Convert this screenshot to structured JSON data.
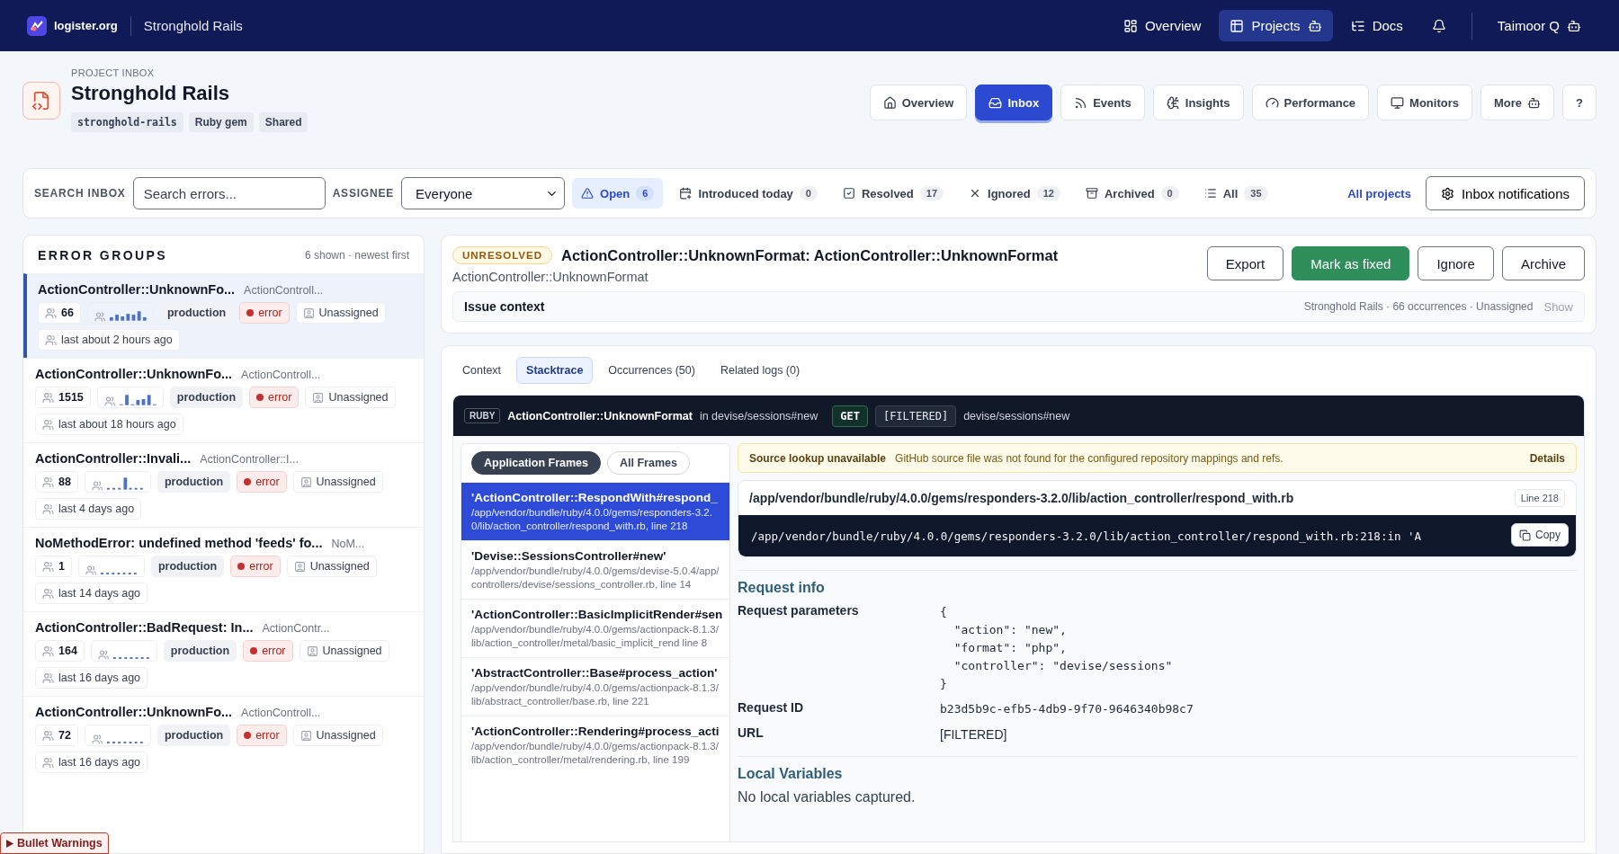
{
  "nav": {
    "brand": "logister.org",
    "project": "Stronghold Rails",
    "items": [
      {
        "label": "Overview",
        "selected": false
      },
      {
        "label": "Projects",
        "selected": true
      },
      {
        "label": "Docs",
        "selected": false
      }
    ],
    "user": "Taimoor Q"
  },
  "header": {
    "eyebrow": "PROJECT INBOX",
    "title": "Stronghold Rails",
    "tags": [
      {
        "label": "stronghold-rails",
        "kind": "code"
      },
      {
        "label": "Ruby gem",
        "kind": "plain"
      },
      {
        "label": "Shared",
        "kind": "plain"
      }
    ],
    "tabs": [
      {
        "label": "Overview",
        "selected": false
      },
      {
        "label": "Inbox",
        "selected": true
      },
      {
        "label": "Events",
        "selected": false
      },
      {
        "label": "Insights",
        "selected": false
      },
      {
        "label": "Performance",
        "selected": false
      },
      {
        "label": "Monitors",
        "selected": false
      },
      {
        "label": "More",
        "selected": false
      }
    ],
    "help": "?"
  },
  "filters": {
    "search_label": "SEARCH INBOX",
    "search_placeholder": "Search errors...",
    "assignee_label": "ASSIGNEE",
    "assignee": "Everyone",
    "statuses": [
      {
        "label": "Open",
        "count": "6",
        "selected": true
      },
      {
        "label": "Introduced today",
        "count": "0",
        "selected": false
      },
      {
        "label": "Resolved",
        "count": "17",
        "selected": false
      },
      {
        "label": "Ignored",
        "count": "12",
        "selected": false
      },
      {
        "label": "Archived",
        "count": "0",
        "selected": false
      },
      {
        "label": "All",
        "count": "35",
        "selected": false
      }
    ],
    "all_projects": "All projects",
    "notifications": "Inbox notifications"
  },
  "groups": {
    "title": "ERROR GROUPS",
    "meta": "6 shown · newest first",
    "items": [
      {
        "title": "ActionController::UnknownFo...",
        "subtitle": "ActionControll...",
        "count": "66",
        "env": "production",
        "level": "error",
        "assignee": "Unassigned",
        "last": "last about 2 hours ago",
        "selected": true
      },
      {
        "title": "ActionController::UnknownFo...",
        "subtitle": "ActionControll...",
        "count": "1515",
        "env": "production",
        "level": "error",
        "assignee": "Unassigned",
        "last": "last about 18 hours ago",
        "selected": false
      },
      {
        "title": "ActionController::Invali...",
        "subtitle": "ActionController::I...",
        "count": "88",
        "env": "production",
        "level": "error",
        "assignee": "Unassigned",
        "last": "last 4 days ago",
        "selected": false
      },
      {
        "title": "NoMethodError: undefined method 'feeds' fo...",
        "subtitle": "NoM...",
        "count": "1",
        "env": "production",
        "level": "error",
        "assignee": "Unassigned",
        "last": "last 14 days ago",
        "selected": false
      },
      {
        "title": "ActionController::BadRequest: In...",
        "subtitle": "ActionContr...",
        "count": "164",
        "env": "production",
        "level": "error",
        "assignee": "Unassigned",
        "last": "last 16 days ago",
        "selected": false
      },
      {
        "title": "ActionController::UnknownFo...",
        "subtitle": "ActionControll...",
        "count": "72",
        "env": "production",
        "level": "error",
        "assignee": "Unassigned",
        "last": "last 16 days ago",
        "selected": false
      }
    ]
  },
  "issue": {
    "status": "UNRESOLVED",
    "title": "ActionController::UnknownFormat: ActionController::UnknownFormat",
    "subtitle": "ActionController::UnknownFormat",
    "actions": [
      {
        "label": "Export",
        "kind": "outline"
      },
      {
        "label": "Mark as fixed",
        "kind": "primary"
      },
      {
        "label": "Ignore",
        "kind": "outline"
      },
      {
        "label": "Archive",
        "kind": "outline"
      }
    ],
    "context": {
      "label": "Issue context",
      "meta": "Stronghold Rails · 66 occurrences · Unassigned",
      "toggle": "Show"
    }
  },
  "detail_tabs": [
    {
      "label": "Context",
      "selected": false
    },
    {
      "label": "Stacktrace",
      "selected": true
    },
    {
      "label": "Occurrences (50)",
      "selected": false
    },
    {
      "label": "Related logs (0)",
      "selected": false
    }
  ],
  "stack": {
    "language": "RUBY",
    "exception": "ActionController::UnknownFormat",
    "location": "in devise/sessions#new",
    "method": "GET",
    "url": "[FILTERED]",
    "route": "devise/sessions#new",
    "frame_filters": [
      {
        "label": "Application Frames",
        "selected": true
      },
      {
        "label": "All Frames",
        "selected": false
      }
    ],
    "frames": [
      {
        "name": "'ActionController::RespondWith#respond_",
        "path": "/app/vendor/bundle/ruby/4.0.0/gems/responders-3.2.0/lib/action_controller/respond_with.rb, line 218",
        "selected": true
      },
      {
        "name": "'Devise::SessionsController#new'",
        "path": "/app/vendor/bundle/ruby/4.0.0/gems/devise-5.0.4/app/controllers/devise/sessions_controller.rb, line 14",
        "selected": false
      },
      {
        "name": "'ActionController::BasicImplicitRender#sen",
        "path": "/app/vendor/bundle/ruby/4.0.0/gems/actionpack-8.1.3/lib/action_controller/metal/basic_implicit_rend line 8",
        "selected": false
      },
      {
        "name": "'AbstractController::Base#process_action'",
        "path": "/app/vendor/bundle/ruby/4.0.0/gems/actionpack-8.1.3/lib/abstract_controller/base.rb, line 221",
        "selected": false
      },
      {
        "name": "'ActionController::Rendering#process_acti",
        "path": "/app/vendor/bundle/ruby/4.0.0/gems/actionpack-8.1.3/lib/action_controller/metal/rendering.rb, line 199",
        "selected": false
      }
    ],
    "notice": {
      "title": "Source lookup unavailable",
      "message": "GitHub source file was not found for the configured repository mappings and refs.",
      "link": "Details"
    },
    "file": {
      "path": "/app/vendor/bundle/ruby/4.0.0/gems/responders-3.2.0/lib/action_controller/respond_with.rb",
      "line": "Line 218",
      "code": "/app/vendor/bundle/ruby/4.0.0/gems/responders-3.2.0/lib/action_controller/respond_with.rb:218:in 'A",
      "copy": "Copy"
    },
    "request": {
      "title": "Request info",
      "rows": [
        {
          "label": "Request parameters",
          "lines": [
            "{",
            "  \"action\": \"new\",",
            "  \"format\": \"php\",",
            "  \"controller\": \"devise/sessions\"",
            "}"
          ]
        },
        {
          "label": "Request ID",
          "lines": [
            "b23d5b9c-efb5-4db9-9f70-9646340b98c7"
          ]
        },
        {
          "label": "URL",
          "lines": [
            "[FILTERED]"
          ]
        }
      ]
    },
    "locals": {
      "title": "Local Variables",
      "empty": "No local variables captured."
    }
  },
  "debug_badge": "Bullet Warnings"
}
